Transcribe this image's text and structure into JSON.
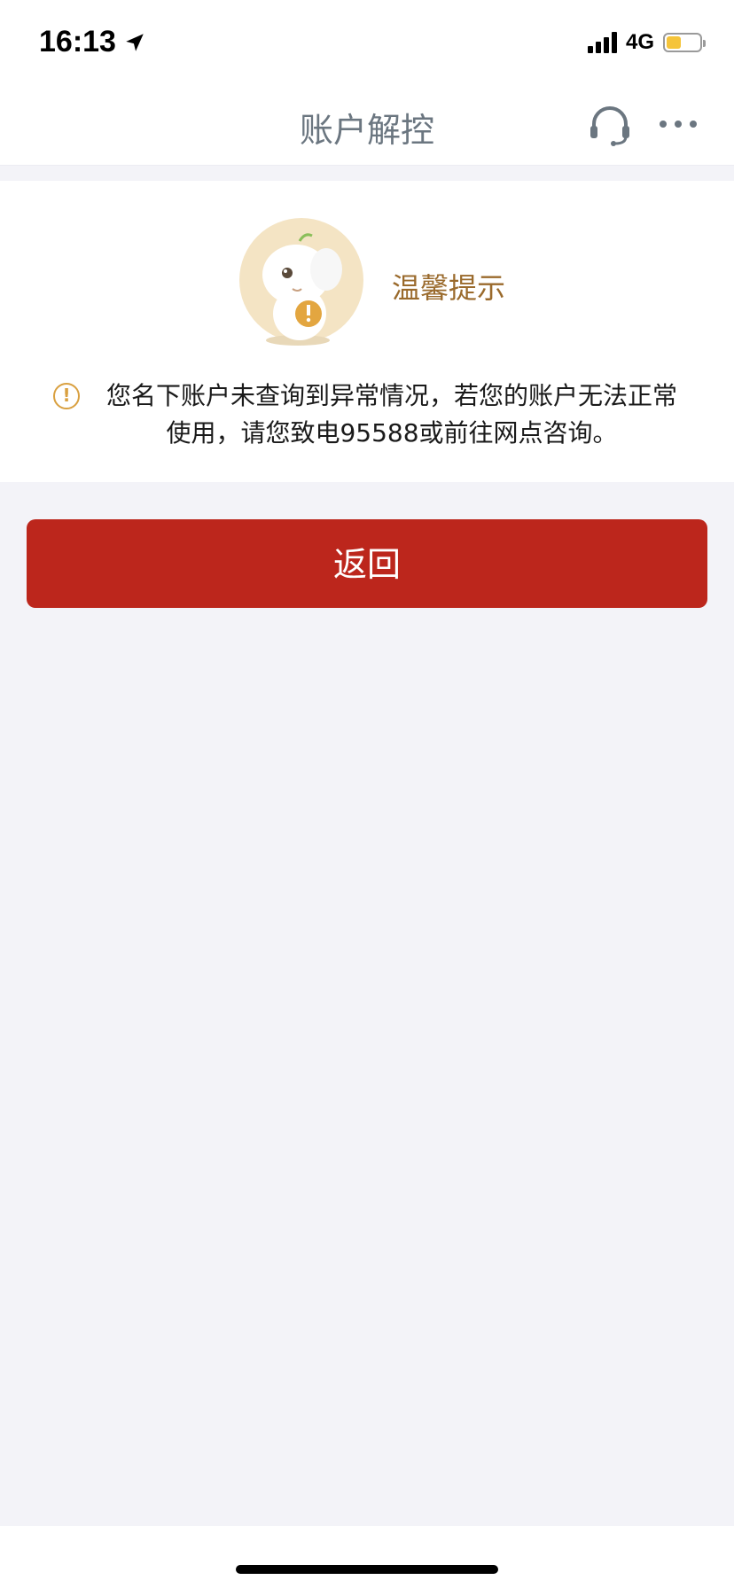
{
  "status_bar": {
    "time": "16:13",
    "network": "4G",
    "battery_fill_fraction": 0.45,
    "battery_color": "#f5c43a",
    "icons": [
      "location-arrow-icon",
      "signal-icon",
      "battery-icon"
    ]
  },
  "nav": {
    "title": "账户解控",
    "icons": [
      "headset-icon",
      "more-icon"
    ]
  },
  "notice": {
    "mascot_label": "温馨提示",
    "message": "您名下账户未查询到异常情况，若您的账户无法正常使用，请您致电95588或前往网点咨询。",
    "icon": "warning-icon"
  },
  "actions": {
    "back_label": "返回"
  },
  "colors": {
    "accent_red": "#bc261c",
    "notice_gold": "#9a6a2c",
    "warning_orange": "#d9a040",
    "page_background": "#f3f3f8"
  }
}
